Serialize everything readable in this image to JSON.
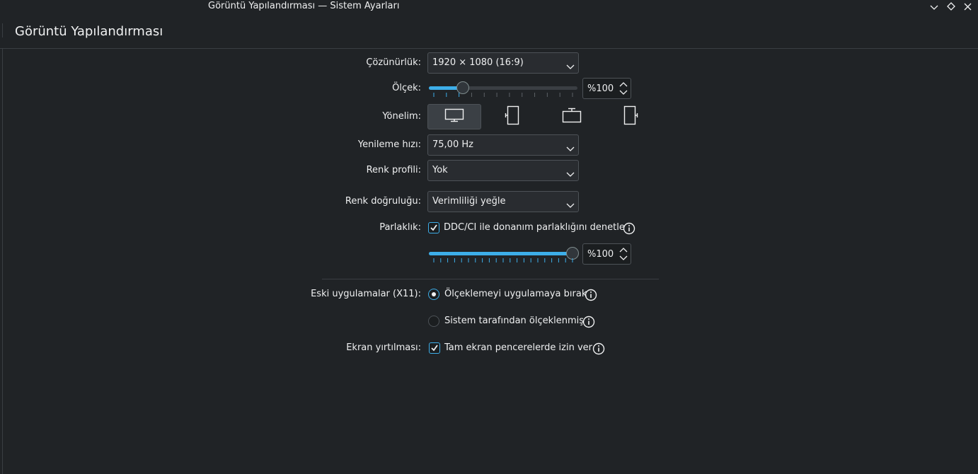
{
  "window": {
    "title": "Görüntü Yapılandırması — Sistem Ayarları",
    "controls": [
      "chevron-down-icon",
      "diamond-icon",
      "close-icon"
    ]
  },
  "header": {
    "title": "Görüntü Yapılandırması"
  },
  "form": {
    "resolution": {
      "label": "Çözünürlük:",
      "value": "1920 × 1080 (16:9)"
    },
    "scale": {
      "label": "Ölçek:",
      "slider_fraction": 0.21,
      "spin_value": "%100"
    },
    "orientation": {
      "label": "Yönelim:",
      "options": [
        "landscape-monitor-icon",
        "portrait-left-icon",
        "landscape-flipped-icon",
        "portrait-right-icon"
      ],
      "selected_index": 0
    },
    "refresh_rate": {
      "label": "Yenileme hızı:",
      "value": "75,00 Hz"
    },
    "color_profile": {
      "label": "Renk profili:",
      "value": "Yok"
    },
    "color_accuracy": {
      "label": "Renk doğruluğu:",
      "value": "Verimliliği yeğle"
    },
    "brightness": {
      "label": "Parlaklık:",
      "ddc_checkbox": {
        "text": "DDC/CI ile donanım parlaklığını denetle",
        "checked": true
      },
      "slider_fraction": 1.0,
      "spin_value": "%100"
    },
    "legacy_apps": {
      "label": "Eski uygulamalar (X11):",
      "options": [
        {
          "text": "Ölçeklemeyi uygulamaya bırak",
          "checked": true
        },
        {
          "text": "Sistem tarafından ölçeklenmiş",
          "checked": false
        }
      ]
    },
    "tearing": {
      "label": "Ekran yırtılması:",
      "checkbox": {
        "text": "Tam ekran pencerelerde izin ver",
        "checked": true
      }
    }
  },
  "colors": {
    "background": "#202326",
    "accent": "#3daee9",
    "text": "#eff0f1",
    "border": "#4d5257"
  }
}
